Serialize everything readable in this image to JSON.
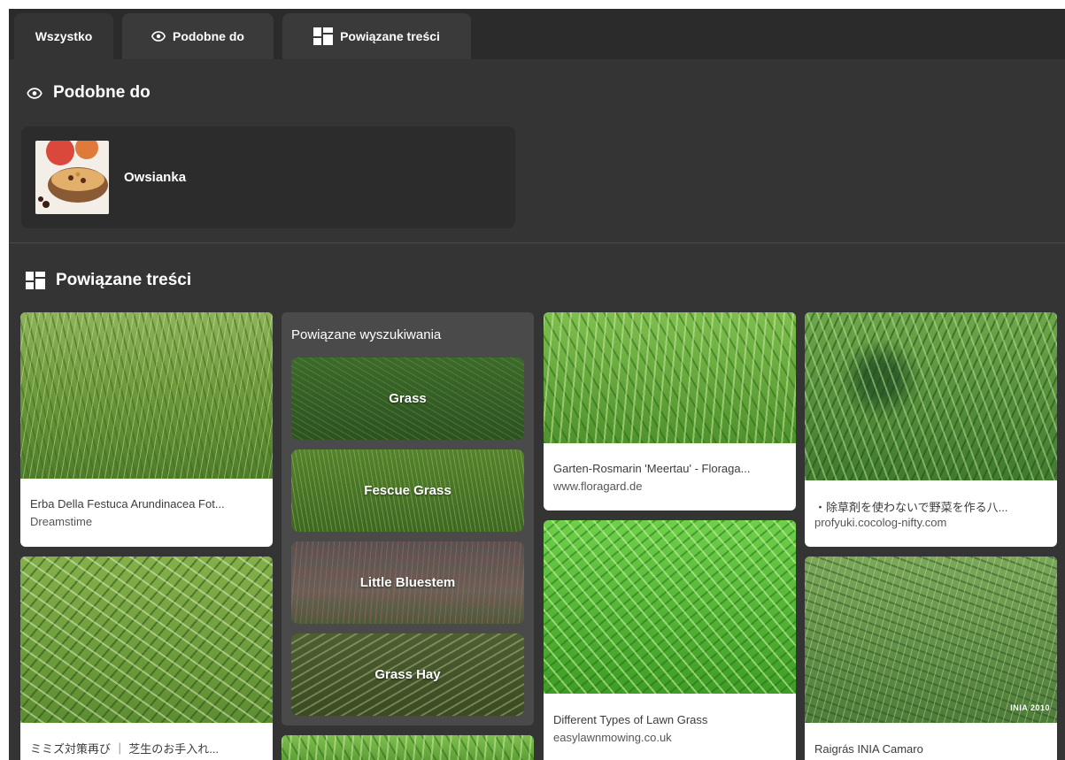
{
  "tabs": [
    {
      "label": "Wszystko",
      "active": true
    },
    {
      "label": "Podobne do",
      "icon": "eye-icon"
    },
    {
      "label": "Powiązane treści",
      "icon": "grid-icon"
    }
  ],
  "similar": {
    "title": "Podobne do",
    "item": {
      "label": "Owsianka"
    }
  },
  "related": {
    "title": "Powiązane treści",
    "searches": {
      "title": "Powiązane wyszukiwania",
      "items": [
        "Grass",
        "Fescue Grass",
        "Little Bluestem",
        "Grass Hay"
      ]
    },
    "cards": [
      {
        "caption": "Erba Della Festuca Arundinacea Fot...",
        "source": "Dreamstime"
      },
      {
        "caption": "ミミズ対策再び ｜ 芝生のお手入れ...",
        "source": ""
      },
      {
        "caption": "Garten-Rosmarin 'Meertau' - Floraga...",
        "source": "www.floragard.de"
      },
      {
        "caption": "Different Types of Lawn Grass",
        "source": "easylawnmowing.co.uk"
      },
      {
        "caption": "・除草剤を使わないで野菜を作る八...",
        "source": "profyuki.cocolog-nifty.com"
      },
      {
        "caption": "Raigrás INIA Camaro",
        "source": "",
        "watermark": "INIA 2010"
      }
    ]
  },
  "colors": {
    "panel": "#343434",
    "tabbar": "#2b2b2b",
    "card": "#ffffff"
  }
}
